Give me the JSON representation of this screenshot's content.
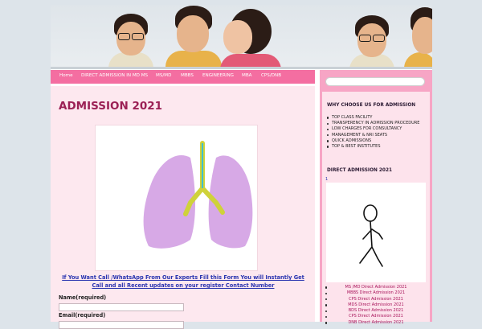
{
  "nav": {
    "items": [
      "Home",
      "DIRECT ADMISSION IN MD MS",
      "MS/MD",
      "MBBS",
      "ENGINEERING",
      "MBA",
      "CPS/DNB"
    ]
  },
  "main": {
    "title": "ADMISSION 2021",
    "media_caption": "If You Want Call /WhatsApp From Our Experts Fill this Form You will Instantly Get Call and all Recent updates on your register Contact Number",
    "form": {
      "name_label": "Name(required)",
      "email_label": "Email(required)"
    }
  },
  "sidebar": {
    "why_heading": "WHY CHOOSE US FOR ADMISSION",
    "why_items": [
      "TOP CLASS FACILITY",
      "TRANSPERENCY IN ADMISSION PROCEDURE",
      "LOW CHARGES FOR CONSULTANCY",
      "MANAGEMENT & NRI SEATS",
      "QUICK ADMISSIONS",
      "TOP & BEST INSTITUTES"
    ],
    "direct_heading": "DIRECT ADMISSION 2021",
    "small_number": "1",
    "links": [
      "MS /MD Direct Admission 2021",
      "MBBS Direct Admission 2021",
      "CPS Direct Admission 2021",
      "MDS Direct Admission 2021",
      "BDS Direct Admission 2021",
      "CPS Direct Admission 2021",
      "DNB Direct Admission 2021"
    ]
  },
  "colors": {
    "nav_bg": "#f46ea1",
    "content_bg": "#fde8ef",
    "sidebar_bg": "#f7a5c5",
    "title_color": "#9b2055",
    "link_color": "#2a35b0"
  }
}
